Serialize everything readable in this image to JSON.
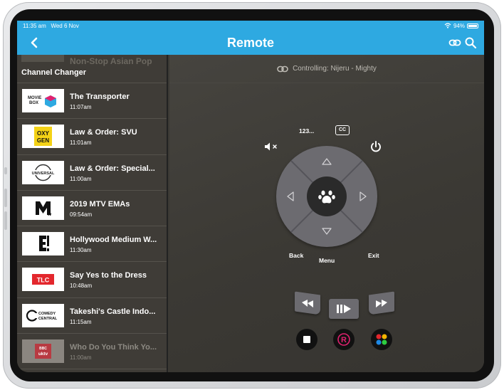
{
  "status": {
    "time": "11:35 am",
    "date": "Wed 6 Nov",
    "battery": "94%"
  },
  "header": {
    "title": "Remote"
  },
  "sidebar": {
    "ghost_text": "Non-Stop Asian Pop",
    "title": "Channel Changer",
    "channels": [
      {
        "logo": "movie-box",
        "logo_text": "MOVIE BOX",
        "name": "The Transporter",
        "time": "11:07am"
      },
      {
        "logo": "oxygen",
        "logo_text": "OXY GEN",
        "name": "Law & Order: SVU",
        "time": "11:01am"
      },
      {
        "logo": "universal",
        "logo_text": "UNIVERSAL",
        "name": "Law & Order: Special...",
        "time": "11:00am"
      },
      {
        "logo": "mtv",
        "logo_text": "M",
        "name": "2019 MTV EMAs",
        "time": "09:54am"
      },
      {
        "logo": "e",
        "logo_text": "E!",
        "name": "Hollywood Medium W...",
        "time": "11:30am"
      },
      {
        "logo": "tlc",
        "logo_text": "TLC",
        "name": "Say Yes to the Dress",
        "time": "10:48am"
      },
      {
        "logo": "comedy-central",
        "logo_text": "COMEDY CENTRAL",
        "name": "Takeshi's Castle Indo...",
        "time": "11:15am"
      },
      {
        "logo": "bbc-uktv",
        "logo_text": "BBC uktv",
        "name": "Who Do You Think Yo...",
        "time": "11:00am"
      }
    ]
  },
  "remote": {
    "controlling": "Controlling: Nijeru - Mighty",
    "numpad_label": "123...",
    "cc_label": "CC",
    "back_label": "Back",
    "menu_label": "Menu",
    "exit_label": "Exit"
  },
  "colors": {
    "accent": "#2ea9e1",
    "record": "#e0216f",
    "bg": "#3b3934"
  }
}
